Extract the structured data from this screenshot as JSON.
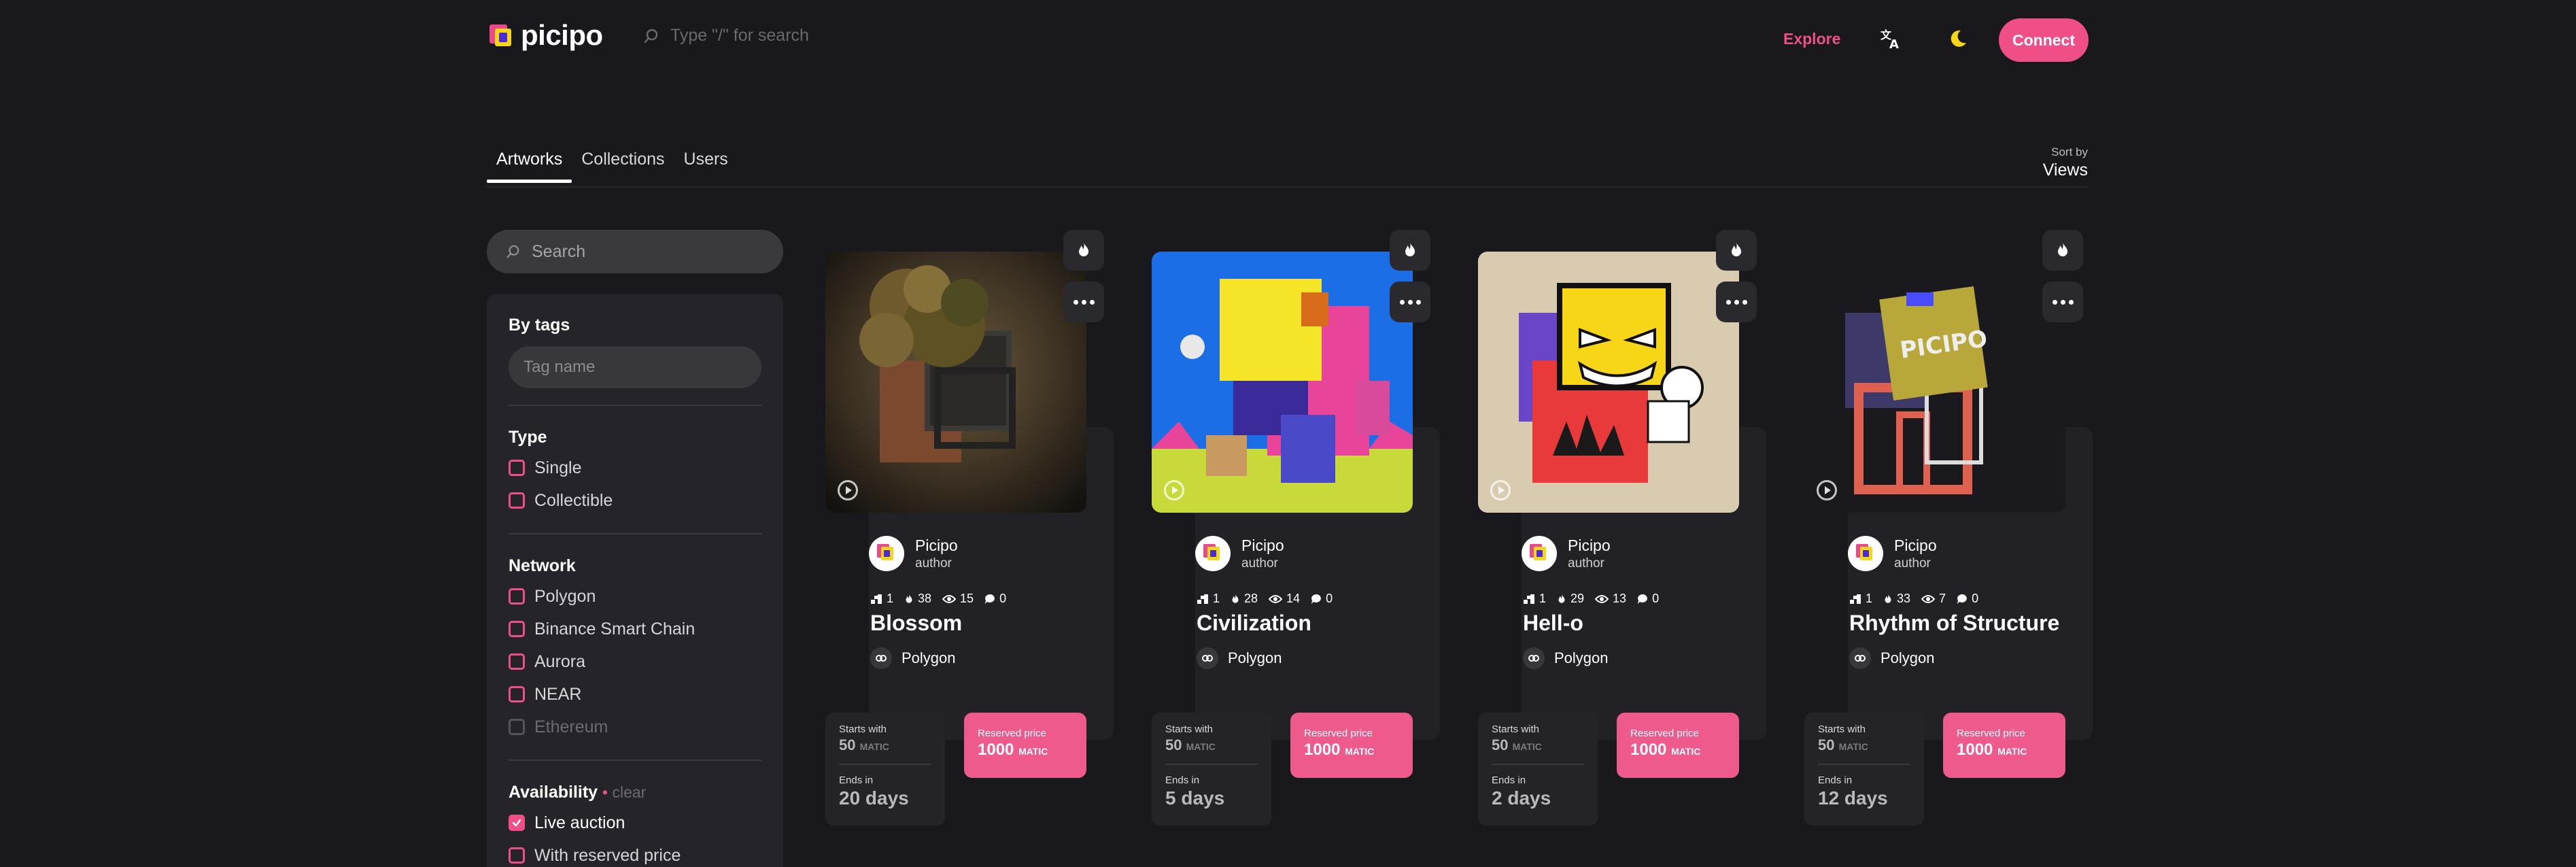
{
  "header": {
    "logo_text": "picipo",
    "search_placeholder": "Type \"/\" for search",
    "explore": "Explore",
    "connect": "Connect"
  },
  "tabs": [
    "Artworks",
    "Collections",
    "Users"
  ],
  "sort": {
    "label": "Sort by",
    "value": "Views"
  },
  "sidebar": {
    "search_placeholder": "Search",
    "tags_title": "By tags",
    "tag_placeholder": "Tag name",
    "type_title": "Type",
    "type_options": [
      "Single",
      "Collectible"
    ],
    "network_title": "Network",
    "network_options": [
      "Polygon",
      "Binance Smart Chain",
      "Aurora",
      "NEAR",
      "Ethereum"
    ],
    "availability_title": "Availability",
    "availability_clear": "clear",
    "availability_options": [
      "Live auction",
      "With reserved price"
    ]
  },
  "cards": [
    {
      "author": "Picipo",
      "role": "author",
      "editions": "1",
      "likes": "38",
      "views": "15",
      "comments": "0",
      "title": "Blossom",
      "network": "Polygon",
      "starts_label": "Starts with",
      "starts_value": "50",
      "currency": "MATIC",
      "ends_label": "Ends in",
      "ends_value": "20 days",
      "reserved_label": "Reserved price",
      "reserved_value": "1000"
    },
    {
      "author": "Picipo",
      "role": "author",
      "editions": "1",
      "likes": "28",
      "views": "14",
      "comments": "0",
      "title": "Civilization",
      "network": "Polygon",
      "starts_label": "Starts with",
      "starts_value": "50",
      "currency": "MATIC",
      "ends_label": "Ends in",
      "ends_value": "5 days",
      "reserved_label": "Reserved price",
      "reserved_value": "1000"
    },
    {
      "author": "Picipo",
      "role": "author",
      "editions": "1",
      "likes": "29",
      "views": "13",
      "comments": "0",
      "title": "Hell-o",
      "network": "Polygon",
      "starts_label": "Starts with",
      "starts_value": "50",
      "currency": "MATIC",
      "ends_label": "Ends in",
      "ends_value": "2 days",
      "reserved_label": "Reserved price",
      "reserved_value": "1000"
    },
    {
      "author": "Picipo",
      "role": "author",
      "editions": "1",
      "likes": "33",
      "views": "7",
      "comments": "0",
      "title": "Rhythm of Structure",
      "network": "Polygon",
      "starts_label": "Starts with",
      "starts_value": "50",
      "currency": "MATIC",
      "ends_label": "Ends in",
      "ends_value": "12 days",
      "reserved_label": "Reserved price",
      "reserved_value": "1000"
    }
  ],
  "colors": {
    "accent": "#ef4f86",
    "background": "#19181c",
    "panel": "#25242a"
  }
}
